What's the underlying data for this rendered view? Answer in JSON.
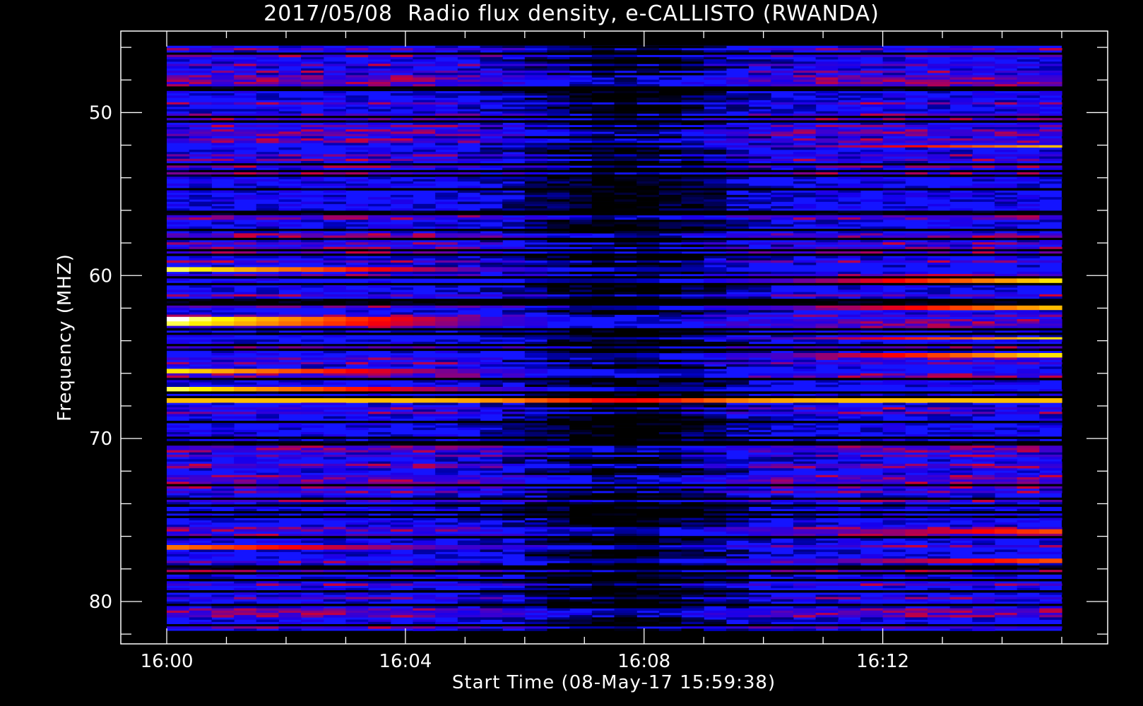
{
  "chart_data": {
    "type": "heatmap",
    "title": "2017/05/08  Radio flux density, e-CALLISTO (RWANDA)",
    "xlabel": "Start Time (08-May-17 15:59:38)",
    "ylabel": "Frequency (MHZ)",
    "x_ticks": [
      "16:00",
      "16:04",
      "16:08",
      "16:12"
    ],
    "x_tick_minutes": [
      0,
      4,
      8,
      12
    ],
    "x_range_minutes": [
      -0.77,
      15.77
    ],
    "data_x_range_minutes": [
      0,
      15
    ],
    "y_ticks": [
      50,
      60,
      70,
      80
    ],
    "y_range": [
      45,
      82.6
    ],
    "data_y_range": [
      45.9,
      81.8
    ],
    "y_reversed": true,
    "grid": false,
    "colormap": [
      "#000000",
      "#0000ff",
      "#ff0000",
      "#ffff00",
      "#ffffff"
    ],
    "bright_bands": [
      {
        "freq": 59.6,
        "intensity": 0.95,
        "side": "left"
      },
      {
        "freq": 60.2,
        "intensity": 0.9,
        "side": "right"
      },
      {
        "freq": 61.9,
        "intensity": 0.85,
        "side": "right"
      },
      {
        "freq": 62.6,
        "intensity": 1.0,
        "side": "left"
      },
      {
        "freq": 62.9,
        "intensity": 0.95,
        "side": "left"
      },
      {
        "freq": 63.8,
        "intensity": 0.9,
        "side": "right"
      },
      {
        "freq": 64.8,
        "intensity": 0.9,
        "side": "right"
      },
      {
        "freq": 65.8,
        "intensity": 0.9,
        "side": "left"
      },
      {
        "freq": 66.9,
        "intensity": 0.95,
        "side": "left"
      },
      {
        "freq": 67.6,
        "intensity": 0.85,
        "side": "both"
      },
      {
        "freq": 52.0,
        "intensity": 0.85,
        "side": "right"
      },
      {
        "freq": 76.6,
        "intensity": 0.75,
        "side": "left"
      },
      {
        "freq": 75.6,
        "intensity": 0.7,
        "side": "right"
      },
      {
        "freq": 77.4,
        "intensity": 0.7,
        "side": "right"
      }
    ]
  }
}
